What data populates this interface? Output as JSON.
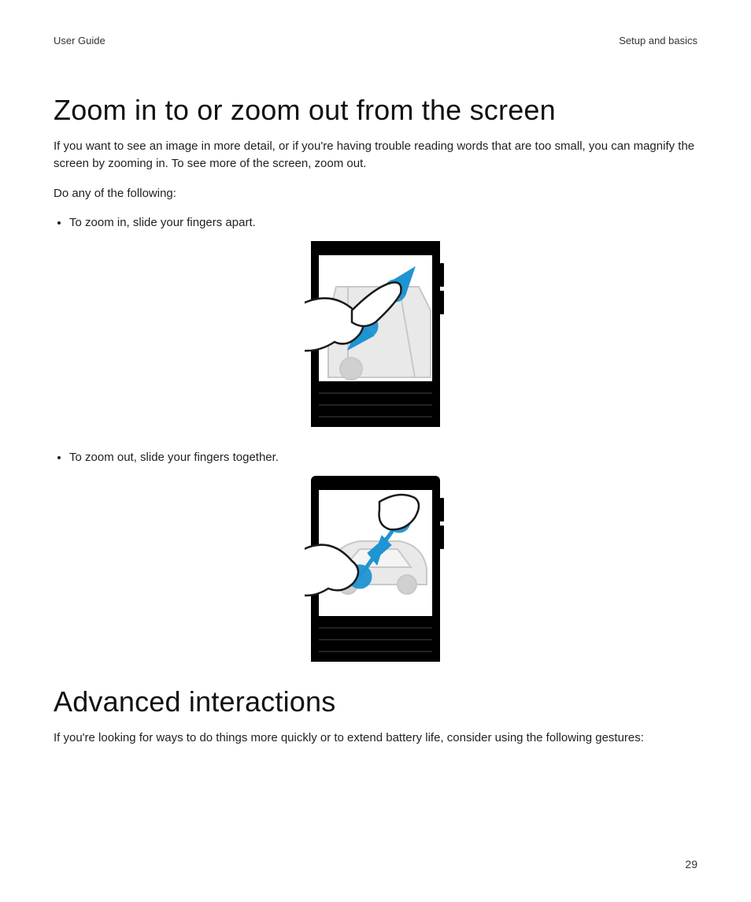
{
  "header": {
    "left": "User Guide",
    "right": "Setup and basics"
  },
  "section1": {
    "title": "Zoom in to or zoom out from the screen",
    "intro": "If you want to see an image in more detail, or if you're having trouble reading words that are too small, you can magnify the screen by zooming in. To see more of the screen, zoom out.",
    "instruction": "Do any of the following:",
    "bullet1": "To zoom in, slide your fingers apart.",
    "bullet2": "To zoom out, slide your fingers together."
  },
  "section2": {
    "title": "Advanced interactions",
    "intro": "If you're looking for ways to do things more quickly or to extend battery life, consider using the following gestures:"
  },
  "page_number": "29"
}
